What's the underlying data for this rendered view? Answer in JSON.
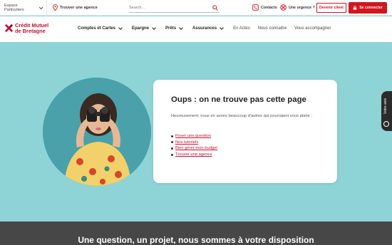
{
  "topbar": {
    "espace": "Espace Particuliers",
    "agence": "Trouver une agence",
    "search_placeholder": "Search...",
    "contacts": "Contacts",
    "urgence": "Une urgence ?",
    "client_button": "Devenir client",
    "login_button": "Se connecter"
  },
  "brand": {
    "line1": "Crédit Mutuel",
    "line2": "de Bretagne",
    "color": "#c8102e"
  },
  "nav": {
    "items": [
      {
        "label": "Comptes et Cartes",
        "dropdown": true
      },
      {
        "label": "Epargne",
        "dropdown": true
      },
      {
        "label": "Prêts",
        "dropdown": true
      },
      {
        "label": "Assurances",
        "dropdown": true
      },
      {
        "label": "En Actes",
        "dropdown": false
      },
      {
        "label": "Nous connaitre",
        "dropdown": false
      },
      {
        "label": "Vous accompagner",
        "dropdown": false
      }
    ]
  },
  "error": {
    "title": "Oups : on ne trouve pas cette page",
    "text": "Heureusement, nous en avons beaucoup d'autres qui pourraient vous plaire :",
    "links": [
      "Poser une question",
      "Nos tutoriels",
      "Bien gérer mon budget",
      "Trouver une agence"
    ]
  },
  "sidetab": {
    "label": "Votre avis"
  },
  "bottom": {
    "title": "Une question, un projet, nous sommes à votre disposition"
  },
  "colors": {
    "accent": "#d2161e",
    "hero_bg": "#8ed4d6",
    "footer_bg": "#474747"
  }
}
